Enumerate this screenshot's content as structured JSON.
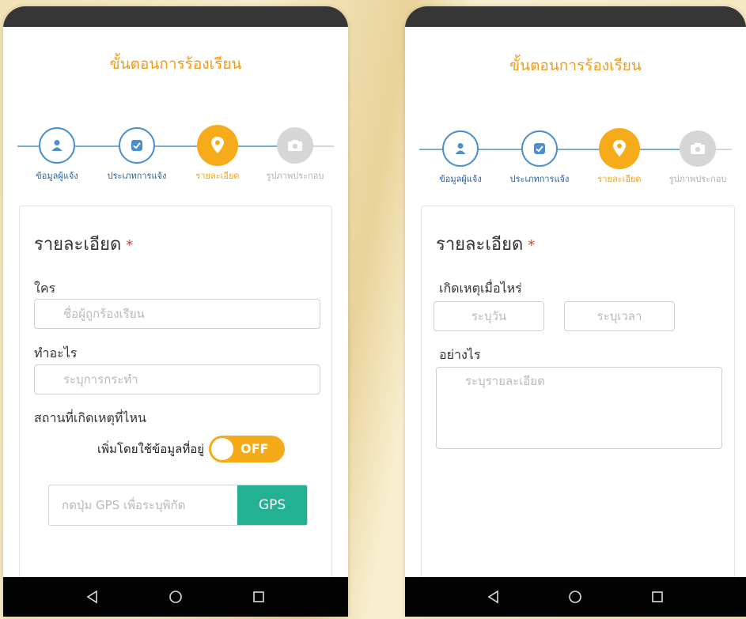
{
  "colors": {
    "accent": "#f6ab1b",
    "step_blue": "#4d8fcc",
    "gps_green": "#22b293",
    "required_red": "#d93a2f"
  },
  "screen_left": {
    "title": "ขั้นตอนการร้องเรียน",
    "steps": [
      {
        "label": "ข้อมูลผู้แจ้ง",
        "icon": "user-icon",
        "state": "done"
      },
      {
        "label": "ประเภทการแจ้ง",
        "icon": "checkbox-icon",
        "state": "done"
      },
      {
        "label": "รายละเอียด",
        "icon": "map-pin-icon",
        "state": "active"
      },
      {
        "label": "รูปภาพประกอบ",
        "icon": "camera-icon",
        "state": "disabled"
      }
    ],
    "form": {
      "heading": "รายละเอียด",
      "required_mark": "*",
      "who_label": "ใคร",
      "who_placeholder": "ชื่อผู้ถูกร้องเรียน",
      "what_label": "ทำอะไร",
      "what_placeholder": "ระบุการกระทำ",
      "where_label": "สถานที่เกิดเหตุที่ไหน",
      "toggle_label": "เพิ่มโดยใช้ข้อมูลที่อยู่",
      "toggle_value": "OFF",
      "gps_placeholder": "กดปุ่ม GPS เพื่อระบุพิกัด",
      "gps_button": "GPS"
    }
  },
  "screen_right": {
    "title": "ขั้นตอนการร้องเรียน",
    "steps": [
      {
        "label": "ข้อมูลผู้แจ้ง",
        "icon": "user-icon",
        "state": "done"
      },
      {
        "label": "ประเภทการแจ้ง",
        "icon": "checkbox-icon",
        "state": "done"
      },
      {
        "label": "รายละเอียด",
        "icon": "map-pin-icon",
        "state": "active"
      },
      {
        "label": "รูปภาพประกอบ",
        "icon": "camera-icon",
        "state": "disabled"
      }
    ],
    "form": {
      "heading": "รายละเอียด",
      "required_mark": "*",
      "when_label": "เกิดเหตุเมื่อไหร่",
      "date_placeholder": "ระบุวัน",
      "time_placeholder": "ระบุเวลา",
      "how_label": "อย่างไร",
      "how_placeholder": "ระบุรายละเอียด"
    }
  },
  "navbar": {
    "icons": [
      "back-icon",
      "home-icon",
      "recents-icon"
    ]
  }
}
